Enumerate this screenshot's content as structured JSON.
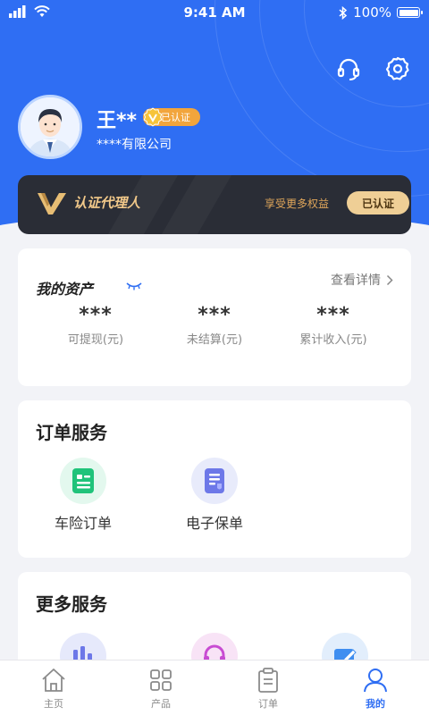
{
  "status_bar": {
    "time": "9:41 AM",
    "battery": "100%"
  },
  "profile": {
    "name": "王**",
    "verified_badge": "已认证",
    "company": "****有限公司"
  },
  "agent_card": {
    "title": "认证代理人",
    "benefit": "享受更多权益",
    "button": "已认证"
  },
  "assets": {
    "title": "我的资产",
    "detail_link": "查看详情",
    "items": [
      {
        "value": "***",
        "label": "可提现(元)"
      },
      {
        "value": "***",
        "label": "未结算(元)"
      },
      {
        "value": "***",
        "label": "累计收入(元)"
      }
    ]
  },
  "order_services": {
    "title": "订单服务",
    "items": [
      {
        "label": "车险订单",
        "icon": "car-insurance-order-icon"
      },
      {
        "label": "电子保单",
        "icon": "e-policy-icon"
      }
    ]
  },
  "more_services": {
    "title": "更多服务",
    "items": [
      {
        "icon": "statistics-icon"
      },
      {
        "icon": "customer-service-icon"
      },
      {
        "icon": "card-edit-icon"
      }
    ]
  },
  "tab_bar": {
    "tabs": [
      {
        "label": "主页",
        "icon": "home-icon"
      },
      {
        "label": "产品",
        "icon": "grid-icon"
      },
      {
        "label": "订单",
        "icon": "clipboard-icon"
      },
      {
        "label": "我的",
        "icon": "user-icon",
        "active": true
      }
    ]
  },
  "colors": {
    "primary": "#2f6ef3",
    "gold": "#efcf96",
    "badge": "#f2a53c",
    "dark_card": "#2a2d36"
  }
}
